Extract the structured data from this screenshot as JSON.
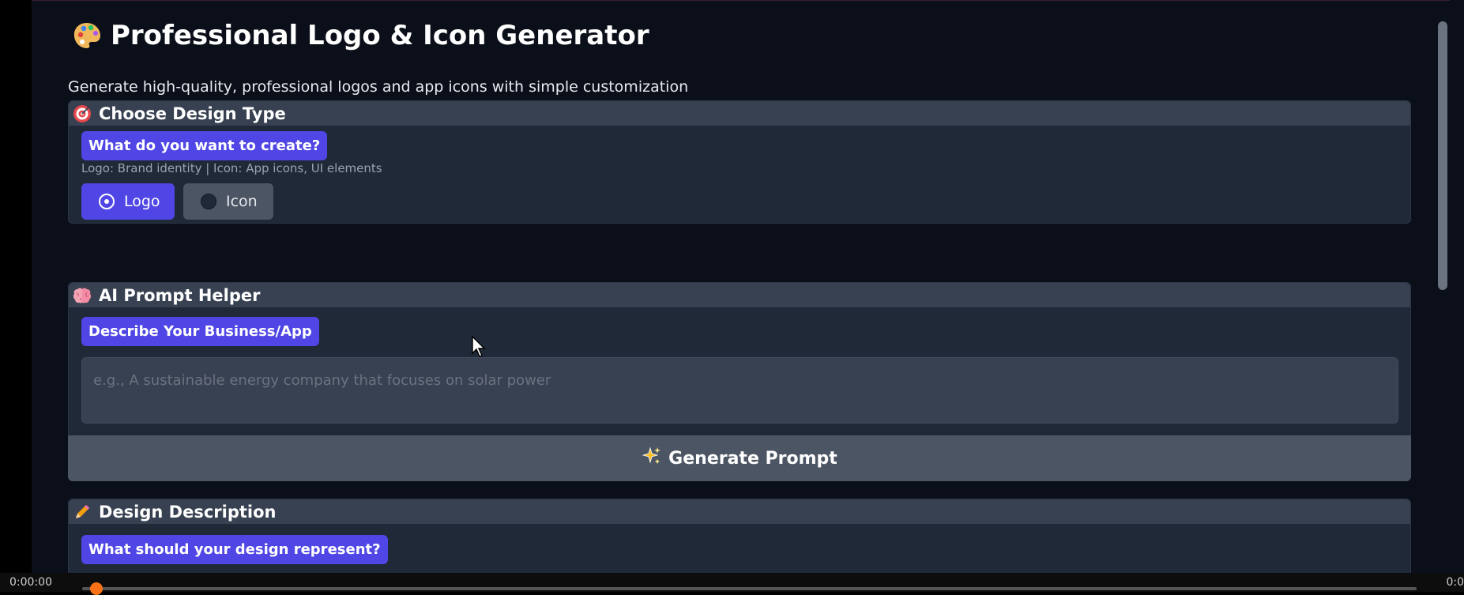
{
  "header": {
    "title": "Professional Logo & Icon Generator",
    "title_icon": "palette-icon",
    "subtitle": "Generate high-quality, professional logos and app icons with simple customization"
  },
  "design_type": {
    "heading": "Choose Design Type",
    "heading_icon": "target-icon",
    "question": "What do you want to create?",
    "hint": "Logo: Brand identity | Icon: App icons, UI elements",
    "options": [
      {
        "label": "Logo",
        "selected": true
      },
      {
        "label": "Icon",
        "selected": false
      }
    ]
  },
  "prompt_helper": {
    "heading": "AI Prompt Helper",
    "heading_icon": "brain-icon",
    "question": "Describe Your Business/App",
    "placeholder": "e.g., A sustainable energy company that focuses on solar power",
    "button_label": "Generate Prompt",
    "button_icon": "sparkles-icon"
  },
  "design_description": {
    "heading": "Design Description",
    "heading_icon": "pencil-icon",
    "question": "What should your design represent?"
  },
  "player": {
    "time_left": "0:00:00",
    "time_right": "0:0"
  },
  "colors": {
    "accent": "#4f46e5",
    "background": "#0b0f19",
    "panel": "#1f2937",
    "panel_header": "#374151",
    "progress_knob": "#f97316"
  }
}
